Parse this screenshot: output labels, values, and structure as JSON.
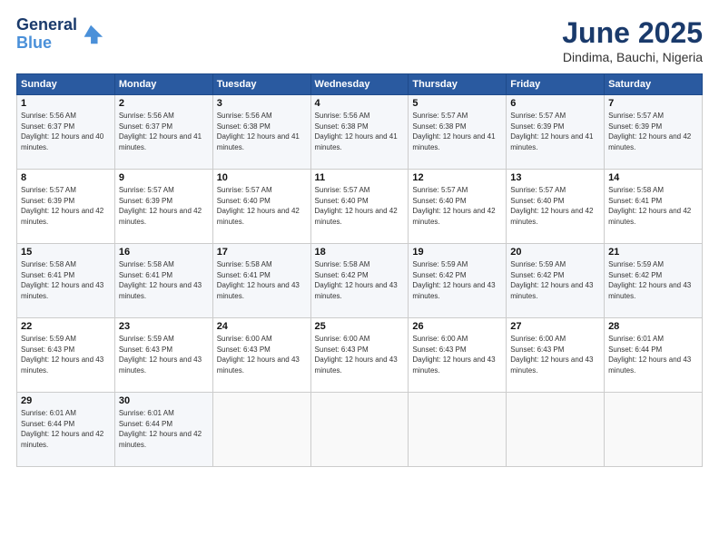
{
  "header": {
    "logo_line1": "General",
    "logo_line2": "Blue",
    "month": "June 2025",
    "location": "Dindima, Bauchi, Nigeria"
  },
  "weekdays": [
    "Sunday",
    "Monday",
    "Tuesday",
    "Wednesday",
    "Thursday",
    "Friday",
    "Saturday"
  ],
  "weeks": [
    [
      {
        "day": "1",
        "sunrise": "5:56 AM",
        "sunset": "6:37 PM",
        "daylight": "12 hours and 40 minutes."
      },
      {
        "day": "2",
        "sunrise": "5:56 AM",
        "sunset": "6:37 PM",
        "daylight": "12 hours and 41 minutes."
      },
      {
        "day": "3",
        "sunrise": "5:56 AM",
        "sunset": "6:38 PM",
        "daylight": "12 hours and 41 minutes."
      },
      {
        "day": "4",
        "sunrise": "5:56 AM",
        "sunset": "6:38 PM",
        "daylight": "12 hours and 41 minutes."
      },
      {
        "day": "5",
        "sunrise": "5:57 AM",
        "sunset": "6:38 PM",
        "daylight": "12 hours and 41 minutes."
      },
      {
        "day": "6",
        "sunrise": "5:57 AM",
        "sunset": "6:39 PM",
        "daylight": "12 hours and 41 minutes."
      },
      {
        "day": "7",
        "sunrise": "5:57 AM",
        "sunset": "6:39 PM",
        "daylight": "12 hours and 42 minutes."
      }
    ],
    [
      {
        "day": "8",
        "sunrise": "5:57 AM",
        "sunset": "6:39 PM",
        "daylight": "12 hours and 42 minutes."
      },
      {
        "day": "9",
        "sunrise": "5:57 AM",
        "sunset": "6:39 PM",
        "daylight": "12 hours and 42 minutes."
      },
      {
        "day": "10",
        "sunrise": "5:57 AM",
        "sunset": "6:40 PM",
        "daylight": "12 hours and 42 minutes."
      },
      {
        "day": "11",
        "sunrise": "5:57 AM",
        "sunset": "6:40 PM",
        "daylight": "12 hours and 42 minutes."
      },
      {
        "day": "12",
        "sunrise": "5:57 AM",
        "sunset": "6:40 PM",
        "daylight": "12 hours and 42 minutes."
      },
      {
        "day": "13",
        "sunrise": "5:57 AM",
        "sunset": "6:40 PM",
        "daylight": "12 hours and 42 minutes."
      },
      {
        "day": "14",
        "sunrise": "5:58 AM",
        "sunset": "6:41 PM",
        "daylight": "12 hours and 42 minutes."
      }
    ],
    [
      {
        "day": "15",
        "sunrise": "5:58 AM",
        "sunset": "6:41 PM",
        "daylight": "12 hours and 43 minutes."
      },
      {
        "day": "16",
        "sunrise": "5:58 AM",
        "sunset": "6:41 PM",
        "daylight": "12 hours and 43 minutes."
      },
      {
        "day": "17",
        "sunrise": "5:58 AM",
        "sunset": "6:41 PM",
        "daylight": "12 hours and 43 minutes."
      },
      {
        "day": "18",
        "sunrise": "5:58 AM",
        "sunset": "6:42 PM",
        "daylight": "12 hours and 43 minutes."
      },
      {
        "day": "19",
        "sunrise": "5:59 AM",
        "sunset": "6:42 PM",
        "daylight": "12 hours and 43 minutes."
      },
      {
        "day": "20",
        "sunrise": "5:59 AM",
        "sunset": "6:42 PM",
        "daylight": "12 hours and 43 minutes."
      },
      {
        "day": "21",
        "sunrise": "5:59 AM",
        "sunset": "6:42 PM",
        "daylight": "12 hours and 43 minutes."
      }
    ],
    [
      {
        "day": "22",
        "sunrise": "5:59 AM",
        "sunset": "6:43 PM",
        "daylight": "12 hours and 43 minutes."
      },
      {
        "day": "23",
        "sunrise": "5:59 AM",
        "sunset": "6:43 PM",
        "daylight": "12 hours and 43 minutes."
      },
      {
        "day": "24",
        "sunrise": "6:00 AM",
        "sunset": "6:43 PM",
        "daylight": "12 hours and 43 minutes."
      },
      {
        "day": "25",
        "sunrise": "6:00 AM",
        "sunset": "6:43 PM",
        "daylight": "12 hours and 43 minutes."
      },
      {
        "day": "26",
        "sunrise": "6:00 AM",
        "sunset": "6:43 PM",
        "daylight": "12 hours and 43 minutes."
      },
      {
        "day": "27",
        "sunrise": "6:00 AM",
        "sunset": "6:43 PM",
        "daylight": "12 hours and 43 minutes."
      },
      {
        "day": "28",
        "sunrise": "6:01 AM",
        "sunset": "6:44 PM",
        "daylight": "12 hours and 43 minutes."
      }
    ],
    [
      {
        "day": "29",
        "sunrise": "6:01 AM",
        "sunset": "6:44 PM",
        "daylight": "12 hours and 42 minutes."
      },
      {
        "day": "30",
        "sunrise": "6:01 AM",
        "sunset": "6:44 PM",
        "daylight": "12 hours and 42 minutes."
      },
      null,
      null,
      null,
      null,
      null
    ]
  ]
}
